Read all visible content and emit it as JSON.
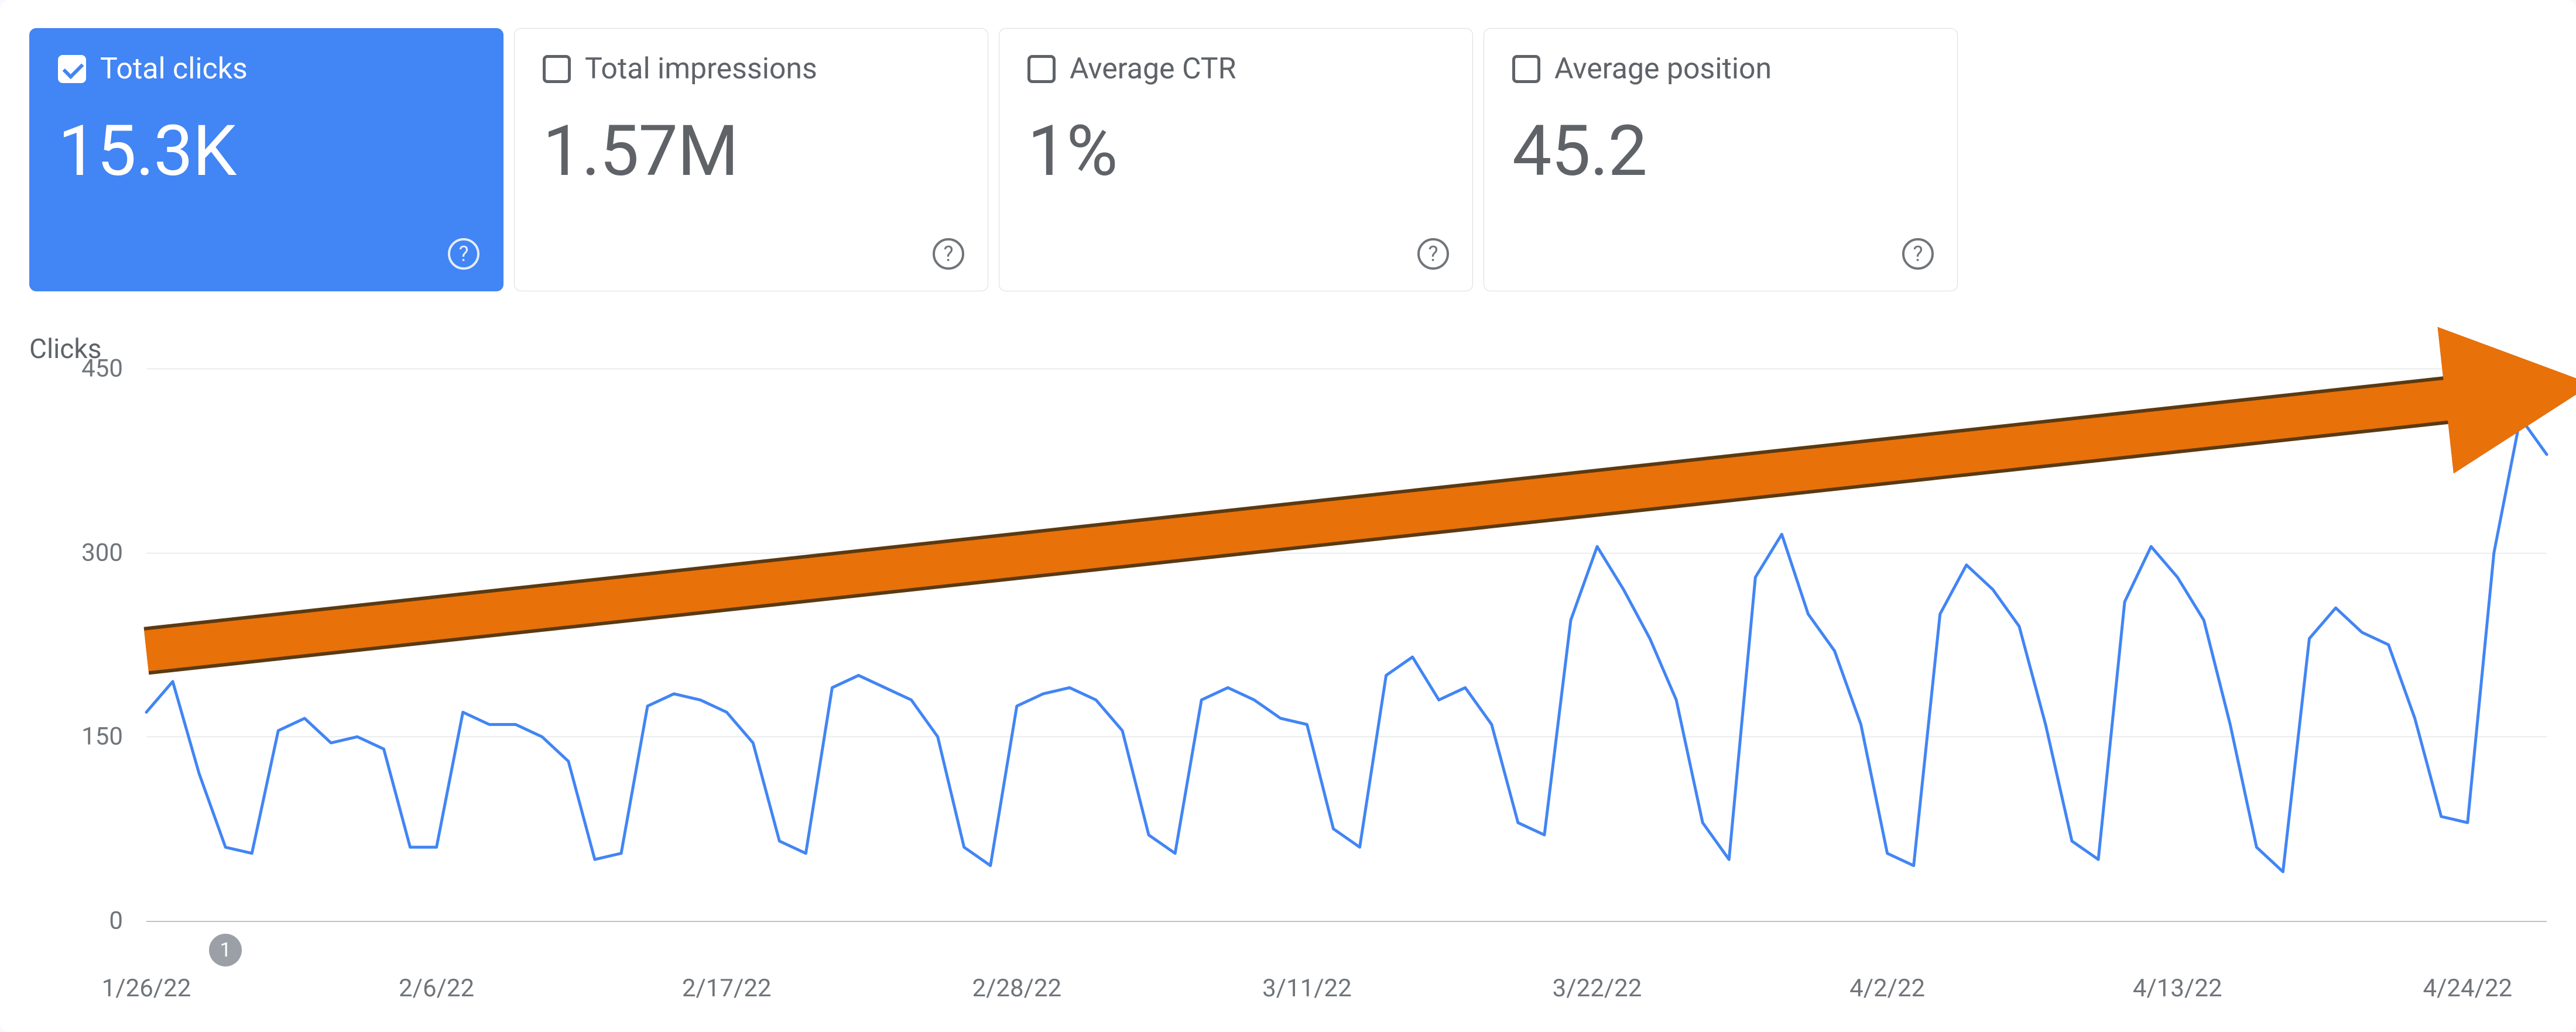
{
  "colors": {
    "active_tile_bg": "#4285f4",
    "line_stroke": "#4285f4",
    "annotation": "#e8710a"
  },
  "tiles": [
    {
      "id": "total-clicks",
      "label": "Total clicks",
      "value": "15.3K",
      "checked": true
    },
    {
      "id": "total-impressions",
      "label": "Total impressions",
      "value": "1.57M",
      "checked": false
    },
    {
      "id": "average-ctr",
      "label": "Average CTR",
      "value": "1%",
      "checked": false
    },
    {
      "id": "average-position",
      "label": "Average position",
      "value": "45.2",
      "checked": false
    }
  ],
  "annotation": {
    "type": "trend-arrow",
    "direction": "up",
    "approx_start_value": 220,
    "approx_end_value": 430
  },
  "event_markers": [
    {
      "label": "1",
      "date": "1/29/22"
    }
  ],
  "chart_data": {
    "type": "line",
    "title": "",
    "ylabel": "Clicks",
    "xlabel": "",
    "ylim": [
      0,
      450
    ],
    "yticks": [
      0,
      150,
      300,
      450
    ],
    "x_tick_labels": [
      "1/26/22",
      "2/6/22",
      "2/17/22",
      "2/28/22",
      "3/11/22",
      "3/22/22",
      "4/2/22",
      "4/13/22",
      "4/24/22"
    ],
    "series": [
      {
        "name": "Clicks",
        "color": "#4285f4",
        "x": [
          "1/26/22",
          "1/27/22",
          "1/28/22",
          "1/29/22",
          "1/30/22",
          "1/31/22",
          "2/1/22",
          "2/2/22",
          "2/3/22",
          "2/4/22",
          "2/5/22",
          "2/6/22",
          "2/7/22",
          "2/8/22",
          "2/9/22",
          "2/10/22",
          "2/11/22",
          "2/12/22",
          "2/13/22",
          "2/14/22",
          "2/15/22",
          "2/16/22",
          "2/17/22",
          "2/18/22",
          "2/19/22",
          "2/20/22",
          "2/21/22",
          "2/22/22",
          "2/23/22",
          "2/24/22",
          "2/25/22",
          "2/26/22",
          "2/27/22",
          "2/28/22",
          "3/1/22",
          "3/2/22",
          "3/3/22",
          "3/4/22",
          "3/5/22",
          "3/6/22",
          "3/7/22",
          "3/8/22",
          "3/9/22",
          "3/10/22",
          "3/11/22",
          "3/12/22",
          "3/13/22",
          "3/14/22",
          "3/15/22",
          "3/16/22",
          "3/17/22",
          "3/18/22",
          "3/19/22",
          "3/20/22",
          "3/21/22",
          "3/22/22",
          "3/23/22",
          "3/24/22",
          "3/25/22",
          "3/26/22",
          "3/27/22",
          "3/28/22",
          "3/29/22",
          "3/30/22",
          "3/31/22",
          "4/1/22",
          "4/2/22",
          "4/3/22",
          "4/4/22",
          "4/5/22",
          "4/6/22",
          "4/7/22",
          "4/8/22",
          "4/9/22",
          "4/10/22",
          "4/11/22",
          "4/12/22",
          "4/13/22",
          "4/14/22",
          "4/15/22",
          "4/16/22",
          "4/17/22",
          "4/18/22",
          "4/19/22",
          "4/20/22",
          "4/21/22",
          "4/22/22",
          "4/23/22",
          "4/24/22",
          "4/25/22",
          "4/26/22"
        ],
        "values": [
          170,
          195,
          120,
          60,
          55,
          155,
          165,
          145,
          150,
          140,
          60,
          60,
          170,
          160,
          160,
          150,
          130,
          50,
          55,
          175,
          185,
          180,
          170,
          145,
          65,
          55,
          190,
          200,
          190,
          180,
          150,
          60,
          45,
          175,
          185,
          190,
          180,
          155,
          70,
          55,
          180,
          190,
          180,
          165,
          160,
          75,
          60,
          200,
          215,
          180,
          190,
          160,
          80,
          70,
          245,
          305,
          270,
          230,
          180,
          80,
          50,
          280,
          315,
          250,
          220,
          160,
          55,
          45,
          250,
          290,
          270,
          240,
          160,
          65,
          50,
          260,
          305,
          280,
          245,
          160,
          60,
          40,
          230,
          255,
          235,
          225,
          165,
          85,
          80,
          300,
          410,
          380
        ]
      }
    ],
    "last_visible_index_partial": 90
  }
}
